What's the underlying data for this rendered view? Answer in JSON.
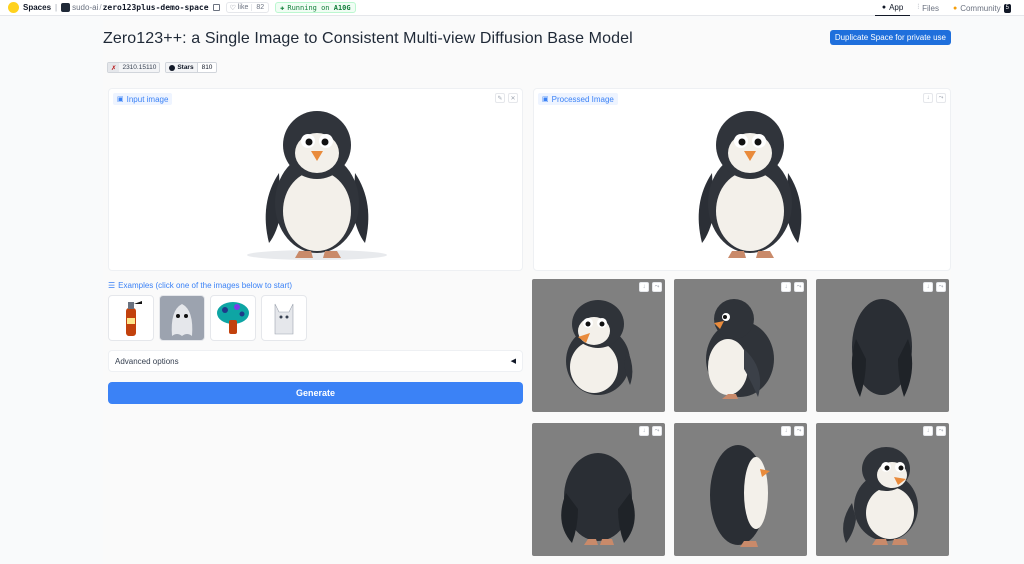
{
  "topbar": {
    "spaces_label": "Spaces",
    "org": "sudo-ai",
    "repo": "zero123plus-demo-space",
    "like_label": "like",
    "like_count": "82",
    "running_prefix": "Running on",
    "running_hw": "A10G",
    "tabs": [
      {
        "label": "App",
        "icon": "app-icon",
        "active": true
      },
      {
        "label": "Files",
        "icon": "files-icon",
        "active": false
      },
      {
        "label": "Community",
        "icon": "community-icon",
        "active": false,
        "count": "5"
      }
    ]
  },
  "app": {
    "title": "Zero123++: a Single Image to Consistent Multi-view Diffusion Base Model",
    "duplicate_button": "Duplicate Space for private use",
    "badges": {
      "arxiv_id": "2310.15110",
      "github_label": "Stars",
      "github_count": "810"
    },
    "input_panel_label": "Input image",
    "processed_panel_label": "Processed Image",
    "examples_label": "Examples (click one of the images below to start)",
    "examples": [
      {
        "name": "fire-extinguisher-example"
      },
      {
        "name": "ghost-example",
        "selected": true
      },
      {
        "name": "mushroom-example"
      },
      {
        "name": "white-cat-example"
      }
    ],
    "advanced_options": "Advanced options",
    "generate_button": "Generate"
  },
  "colors": {
    "accent": "#3b82f6",
    "duplicate_button": "#1f6fdc",
    "tile_background": "#808080"
  }
}
